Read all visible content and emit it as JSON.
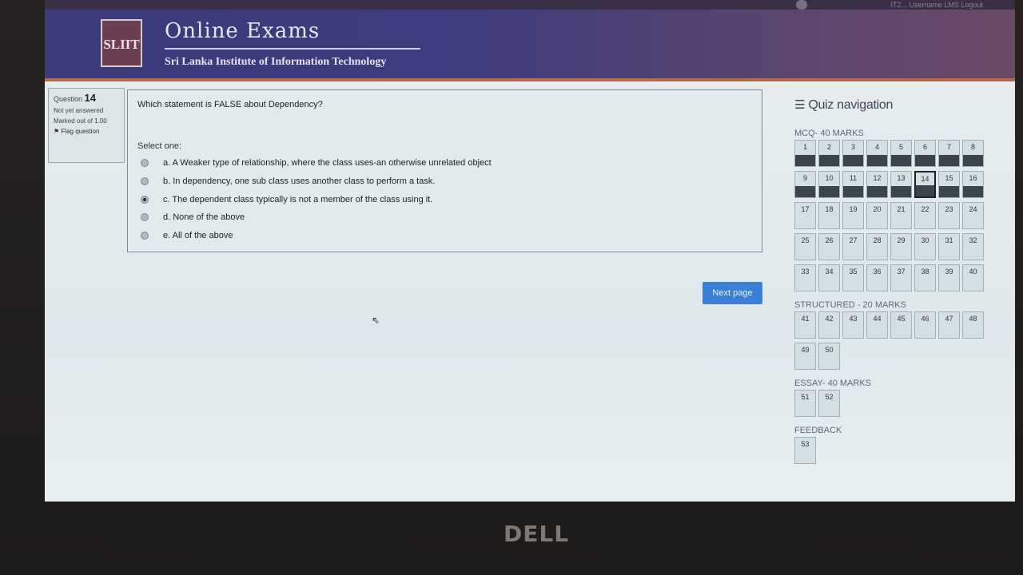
{
  "header": {
    "logo_text": "SLIIT",
    "title": "Online Exams",
    "subtitle": "Sri Lanka Institute of Information Technology",
    "user": "IT2... Username LMS Logout"
  },
  "question_info": {
    "label": "Question",
    "number": "14",
    "status": "Not yet answered",
    "marks": "Marked out of 1.00",
    "flag_label": "Flag question"
  },
  "question": {
    "text": "Which statement is FALSE about Dependency?",
    "select_label": "Select one:",
    "options": [
      {
        "label": "a. A Weaker type of relationship, where the class uses-an otherwise unrelated object",
        "checked": false
      },
      {
        "label": "b. In dependency, one sub class uses another class to perform a task.",
        "checked": false
      },
      {
        "label": "c. The dependent class typically is not a member of the class using it.",
        "checked": true
      },
      {
        "label": "d. None of the above",
        "checked": false
      },
      {
        "label": "e. All of the above",
        "checked": false
      }
    ]
  },
  "next_button": "Next page",
  "quiz_nav": {
    "title": "Quiz navigation",
    "sections": [
      {
        "label": "MCQ- 40 MARKS",
        "start": 1,
        "end": 40,
        "answered": [
          1,
          2,
          3,
          4,
          5,
          6,
          7,
          8,
          9,
          10,
          11,
          12,
          13,
          14,
          15,
          16
        ],
        "current": 14
      },
      {
        "label": "STRUCTURED - 20 MARKS",
        "start": 41,
        "end": 50,
        "answered": [],
        "current": null
      },
      {
        "label": "ESSAY- 40 MARKS",
        "start": 51,
        "end": 52,
        "answered": [],
        "current": null
      },
      {
        "label": "FEEDBACK",
        "start": 53,
        "end": 53,
        "answered": [],
        "current": null
      }
    ]
  },
  "brand": "DELL"
}
